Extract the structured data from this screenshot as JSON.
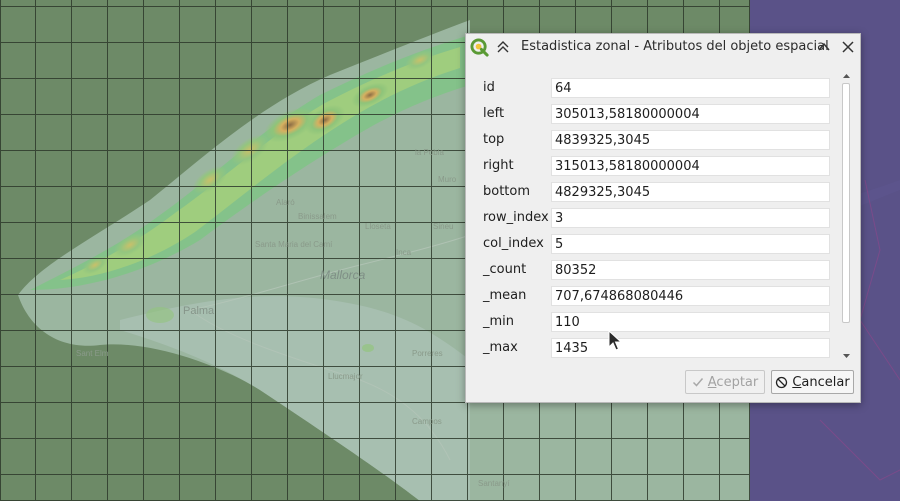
{
  "dialog": {
    "title": "Estadistica zonal - Atributos del objeto espacial",
    "fields": [
      {
        "label": "id",
        "value": "64"
      },
      {
        "label": "left",
        "value": "305013,58180000004"
      },
      {
        "label": "top",
        "value": "4839325,3045"
      },
      {
        "label": "right",
        "value": "315013,58180000004"
      },
      {
        "label": "bottom",
        "value": "4829325,3045"
      },
      {
        "label": "row_index",
        "value": "3"
      },
      {
        "label": "col_index",
        "value": "5"
      },
      {
        "label": "_count",
        "value": "80352"
      },
      {
        "label": "_mean",
        "value": "707,674868080446"
      },
      {
        "label": "_min",
        "value": "110"
      },
      {
        "label": "_max",
        "value": "1435"
      }
    ],
    "buttons": {
      "accept_label": "Aceptar",
      "accept_enabled": false,
      "cancel_label": "Cancelar"
    },
    "icons": {
      "app": "qgis-logo-icon",
      "collapse": "double-chevron-up-icon",
      "minimize": "chevron-up-icon",
      "close": "close-icon",
      "accept": "checkmark-icon",
      "cancel": "cancel-circle-icon"
    }
  },
  "map": {
    "labels": {
      "island": "Mallorca",
      "city": "Palma",
      "inca": "Inca",
      "pollenca": "la Pobla",
      "muro": "Muro",
      "alaro": "Alaró",
      "binissalem": "Binissalem",
      "santa_maria": "Santa Maria del Camí",
      "lloseta": "Lloseta",
      "sineu": "Sineu",
      "porreres": "Porreres",
      "llucmajor": "Llucmajor",
      "campos": "Campos",
      "santanyi": "Santanyí",
      "sant_elm": "Sant Elm"
    },
    "colors": {
      "sea": "#6d8a67",
      "grid": "#2e3a2c",
      "outside_extent": "#5a5288"
    }
  }
}
